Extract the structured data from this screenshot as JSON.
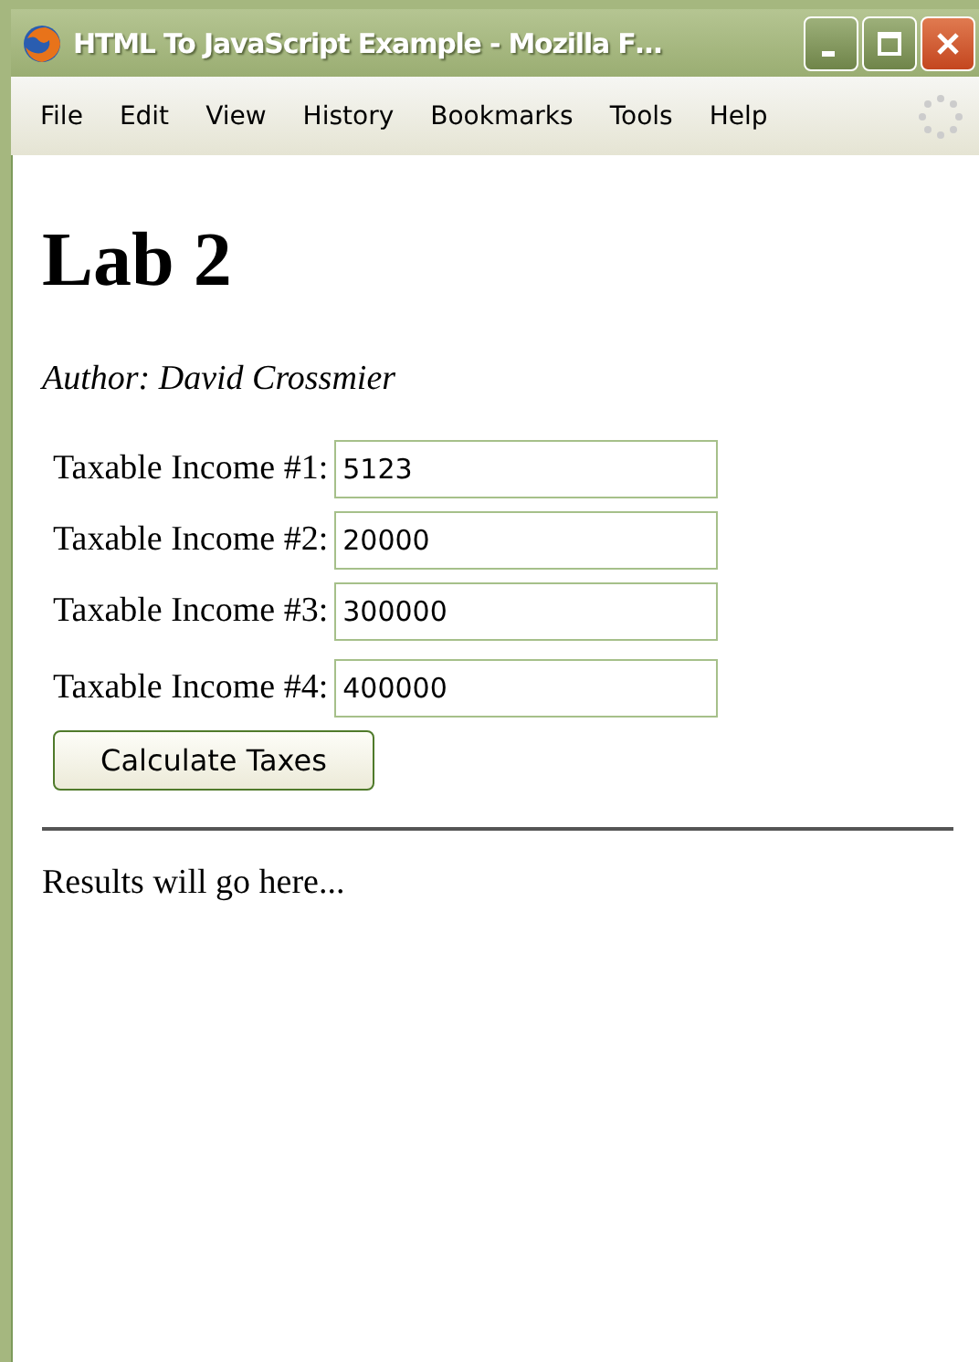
{
  "window": {
    "title": "HTML To JavaScript Example - Mozilla F…"
  },
  "menu": [
    "File",
    "Edit",
    "View",
    "History",
    "Bookmarks",
    "Tools",
    "Help"
  ],
  "page": {
    "heading": "Lab 2",
    "author": "Author: David Crossmier",
    "fields": [
      {
        "label": "Taxable Income #1:",
        "value": "5123"
      },
      {
        "label": "Taxable Income #2:",
        "value": "20000"
      },
      {
        "label": "Taxable Income #3:",
        "value": "300000"
      },
      {
        "label": "Taxable Income #4:",
        "value": "400000"
      }
    ],
    "button": "Calculate Taxes",
    "results": "Results will go here..."
  }
}
